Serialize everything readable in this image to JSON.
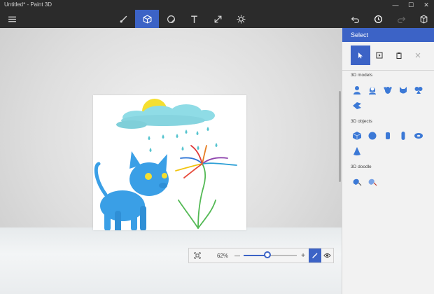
{
  "window": {
    "title": "Untitled* - Paint 3D",
    "controls": [
      "—",
      "☐",
      "✕"
    ]
  },
  "toolbar": {
    "left": [
      "menu-icon"
    ],
    "tools": [
      "brushes-icon",
      "3d-shapes-icon",
      "stickers-icon",
      "text-icon",
      "canvas-icon",
      "effects-icon"
    ],
    "active_tool": "3d-shapes-icon",
    "right": [
      "undo-icon",
      "history-icon",
      "redo-icon",
      "paste-icon"
    ]
  },
  "panel": {
    "header": "Select",
    "tools": [
      "select-icon",
      "select-region-icon",
      "paste-icon",
      "delete-icon"
    ],
    "sections": {
      "models": "3D models",
      "objects": "3D objects",
      "doodle": "3D doodle"
    },
    "models": [
      "man-icon",
      "woman-icon",
      "dog-icon",
      "cat-icon",
      "fish-icon"
    ],
    "objects": [
      "cube-icon",
      "sphere-icon",
      "cylinder-icon",
      "capsule-icon",
      "torus-icon",
      "cone-icon"
    ],
    "doodles": [
      "sharp-doodle-icon",
      "soft-doodle-icon"
    ]
  },
  "zoom": {
    "value_label": "62%",
    "fraction": 0.45,
    "minus": "—",
    "plus": "+"
  },
  "colors": {
    "accent": "#3c63c6",
    "chrome": "#2b2b2b",
    "panel": "#f2f2f2",
    "cat": "#3a9fe6",
    "cloud": "#8fdce6",
    "sun": "#f5df30"
  }
}
